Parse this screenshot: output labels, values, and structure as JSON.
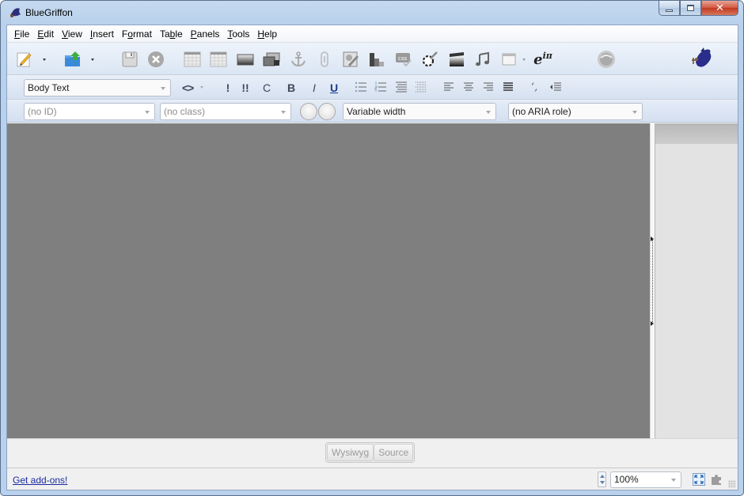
{
  "window": {
    "title": "BlueGriffon",
    "controls": {
      "minimize": "minimize",
      "maximize": "maximize",
      "close": "close"
    }
  },
  "menubar": {
    "items": [
      {
        "label": "File",
        "accel": "F"
      },
      {
        "label": "Edit",
        "accel": "E"
      },
      {
        "label": "View",
        "accel": "V"
      },
      {
        "label": "Insert",
        "accel": "I"
      },
      {
        "label": "Format",
        "accel": "o"
      },
      {
        "label": "Table",
        "accel": "b"
      },
      {
        "label": "Panels",
        "accel": "P"
      },
      {
        "label": "Tools",
        "accel": "T"
      },
      {
        "label": "Help",
        "accel": "H"
      }
    ]
  },
  "main_toolbar": {
    "icons": [
      "new-document-icon",
      "open-publish-icon",
      "save-icon",
      "close-document-icon",
      "table-icon",
      "table-properties-icon",
      "image-icon",
      "image-gallery-icon",
      "anchor-icon",
      "link-icon",
      "form-icon",
      "chart-icon",
      "css-icon",
      "effects-icon",
      "video-icon",
      "audio-icon",
      "window-icon",
      "math-icon",
      "web-icon",
      "bluegriffon-logo-icon"
    ],
    "math_label": "e",
    "math_sup": "iπ"
  },
  "format_toolbar": {
    "paragraph_style": "Body Text",
    "buttons": [
      {
        "name": "markup-button",
        "label": "<>"
      },
      {
        "name": "emphasis-button",
        "label": "!"
      },
      {
        "name": "strong-emphasis-button",
        "label": "!!"
      },
      {
        "name": "code-button",
        "label": "C"
      },
      {
        "name": "bold-button",
        "label": "B"
      },
      {
        "name": "italic-button",
        "label": "I"
      },
      {
        "name": "underline-button",
        "label": "U"
      }
    ],
    "list_align_icons": [
      "bulleted-list-icon",
      "numbered-list-icon",
      "definition-list-icon",
      "definition-term-icon",
      "align-left-icon",
      "align-center-icon",
      "align-right-icon",
      "justify-icon",
      "quote-icon",
      "outdent-icon"
    ]
  },
  "attributes_toolbar": {
    "id_placeholder": "(no ID)",
    "class_placeholder": "(no class)",
    "width_mode": "Variable width",
    "aria_role": "(no ARIA role)"
  },
  "bottom": {
    "modes": [
      "Wysiwyg",
      "Source"
    ]
  },
  "statusbar": {
    "addons_link": "Get add-ons!",
    "zoom": "100%"
  },
  "colors": {
    "editor_bg": "#7f7f7f",
    "titlebar_bg": "#b9d1ec",
    "link": "#1a2aa0",
    "close_button": "#c9452b"
  }
}
